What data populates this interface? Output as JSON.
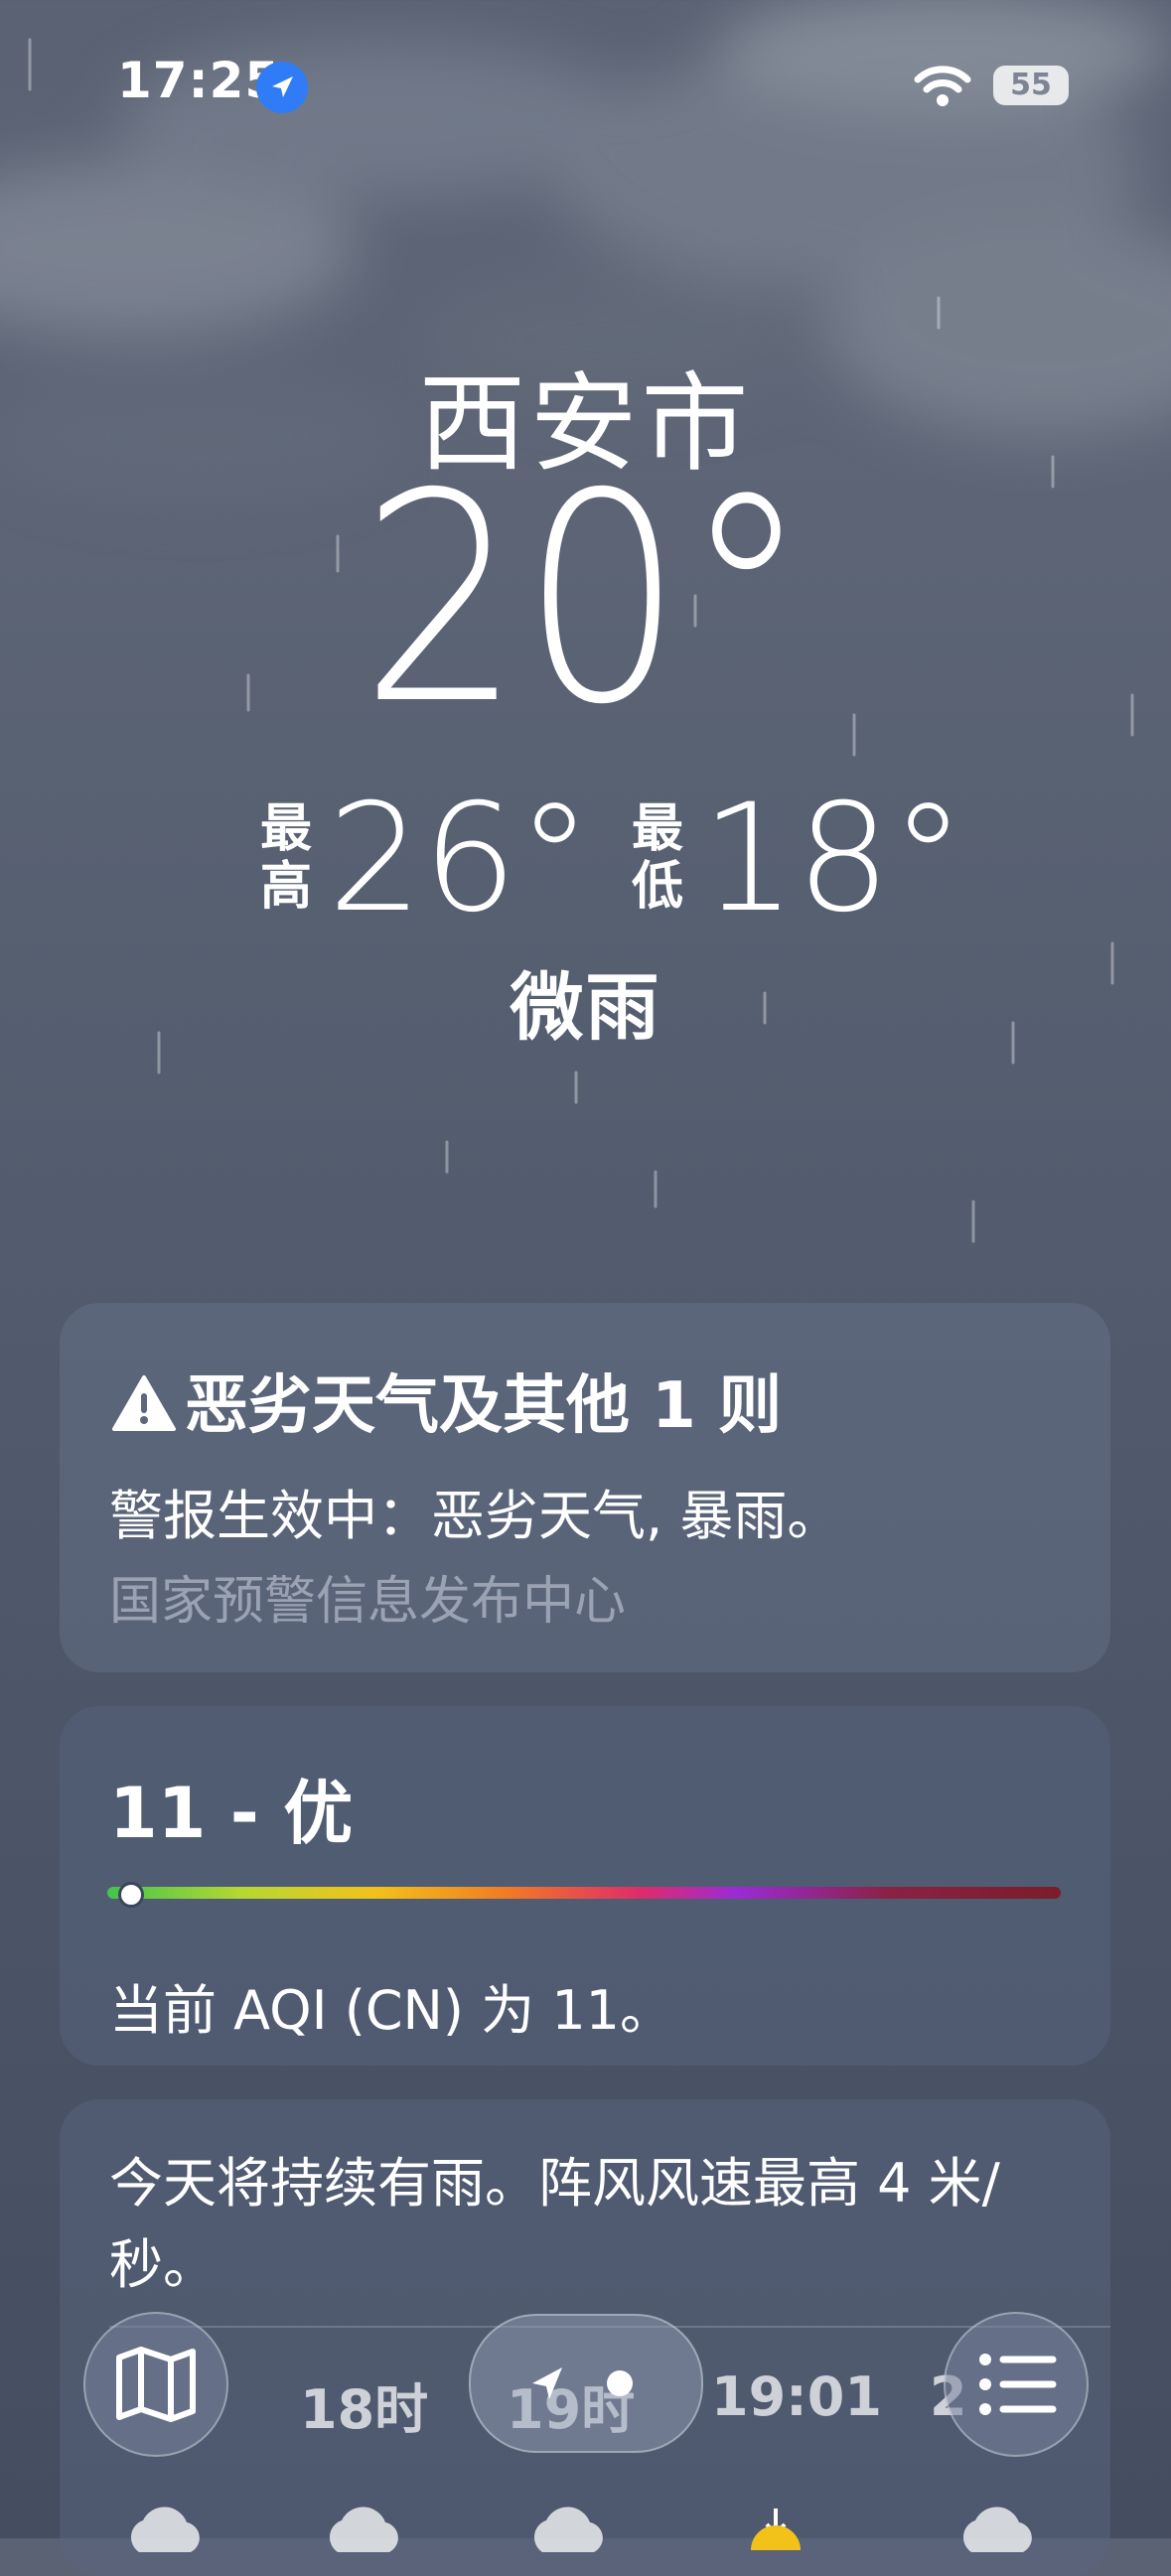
{
  "status_bar": {
    "time": "17:25",
    "battery": "55",
    "icons": [
      "location-arrow-icon",
      "wifi-icon",
      "battery-icon"
    ]
  },
  "weather": {
    "city": "西安市",
    "temperature": "20°",
    "high_label": "最高",
    "high_value": "26°",
    "low_label": "最低",
    "low_value": "18°",
    "condition": "微雨"
  },
  "alert": {
    "icon": "warning-triangle-icon",
    "title": "恶劣天气及其他 1 则",
    "text": "警报生效中：恶劣天气, 暴雨。",
    "source": "国家预警信息发布中心"
  },
  "aqi": {
    "value_text": "11 - 优",
    "value": 11,
    "scale_fraction": 0.022,
    "description": "当前 AQI (CN) 为 11。"
  },
  "forecast": {
    "summary": "今天将持续有雨。阵风风速最高 4 米/秒。",
    "hours": [
      "18时",
      "19时",
      "19:01",
      "2"
    ]
  },
  "toolbar": {
    "map_icon": "map-icon",
    "list_icon": "list-icon",
    "location_icon": "location-arrow-icon"
  },
  "colors": {
    "background": "#566072",
    "card": "#68748c",
    "aqi_good": "#43c34c",
    "location_blue": "#2f7cf6"
  }
}
